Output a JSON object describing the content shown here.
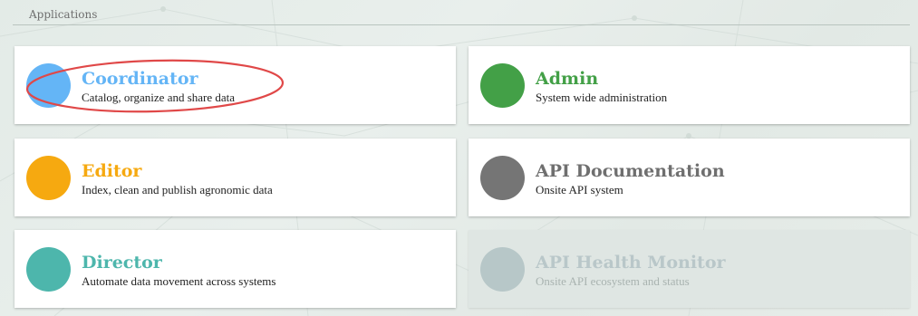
{
  "header": {
    "title": "Applications"
  },
  "apps": [
    {
      "title": "Coordinator",
      "subtitle": "Catalog, organize and share data",
      "color": "#64b5f6",
      "title_color": "#64b5f6",
      "enabled": true
    },
    {
      "title": "Admin",
      "subtitle": "System wide administration",
      "color": "#43a047",
      "title_color": "#43a047",
      "enabled": true
    },
    {
      "title": "Editor",
      "subtitle": "Index, clean and publish agronomic data",
      "color": "#f6a910",
      "title_color": "#f6a910",
      "enabled": true
    },
    {
      "title": "API Documentation",
      "subtitle": "Onsite API system",
      "color": "#757575",
      "title_color": "#6f6f6f",
      "enabled": true
    },
    {
      "title": "Director",
      "subtitle": "Automate data movement across systems",
      "color": "#4db6ac",
      "title_color": "#4db6ac",
      "enabled": true
    },
    {
      "title": "API Health Monitor",
      "subtitle": "Onsite API ecosystem and status",
      "color": "#b7c7c8",
      "title_color": "#b9c7c9",
      "enabled": false
    }
  ],
  "annotation": {
    "highlight_color": "#e04848"
  }
}
